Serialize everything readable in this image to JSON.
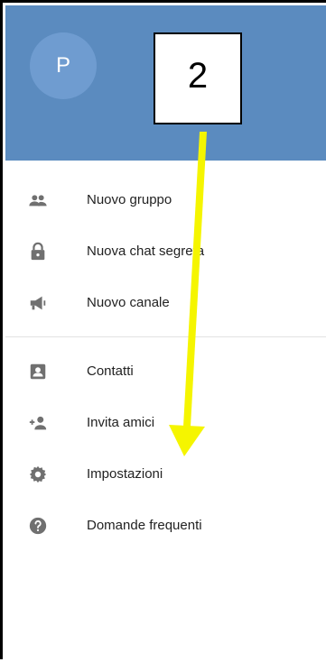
{
  "header": {
    "avatar_letter": "P",
    "background": "#5b8bbf"
  },
  "annotation": {
    "step_number": "2",
    "arrow_color": "#f5f500"
  },
  "menu": {
    "items": [
      {
        "label": "Nuovo gruppo",
        "icon": "group-icon"
      },
      {
        "label": "Nuova chat segreta",
        "icon": "lock-icon"
      },
      {
        "label": "Nuovo canale",
        "icon": "megaphone-icon"
      },
      {
        "label": "Contatti",
        "icon": "contacts-icon"
      },
      {
        "label": "Invita amici",
        "icon": "add-person-icon"
      },
      {
        "label": "Impostazioni",
        "icon": "gear-icon"
      },
      {
        "label": "Domande frequenti",
        "icon": "help-icon"
      }
    ]
  },
  "icon_color": "#6f6f6f"
}
